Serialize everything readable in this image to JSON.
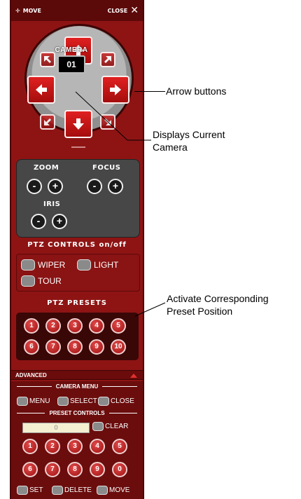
{
  "header": {
    "move_label": "MOVE",
    "close_label": "CLOSE"
  },
  "camera": {
    "label": "CAMERA",
    "number": "01"
  },
  "lens": {
    "zoom_label": "ZOOM",
    "focus_label": "FOCUS",
    "iris_label": "IRIS",
    "minus": "-",
    "plus": "+"
  },
  "ptz_controls": {
    "title": "PTZ CONTROLS on/off",
    "wiper": "WIPER",
    "light": "LIGHT",
    "tour": "TOUR"
  },
  "ptz_presets": {
    "title": "PTZ PRESETS",
    "buttons": [
      "1",
      "2",
      "3",
      "4",
      "5",
      "6",
      "7",
      "8",
      "9",
      "10"
    ]
  },
  "advanced": {
    "label": "ADVANCED"
  },
  "camera_menu": {
    "title": "CAMERA MENU",
    "menu": "MENU",
    "select": "SELECT",
    "close": "CLOSE"
  },
  "preset_controls": {
    "title": "PRESET CONTROLS",
    "entry_value": "0",
    "clear": "CLEAR",
    "keys": [
      "1",
      "2",
      "3",
      "4",
      "5",
      "6",
      "7",
      "8",
      "9",
      "0"
    ],
    "set": "SET",
    "delete": "DELETE",
    "move": "MOVE"
  },
  "annotations": {
    "arrow_buttons": "Arrow buttons",
    "displays_camera_1": "Displays Current",
    "displays_camera_2": "Camera",
    "activate_preset_1": "Activate Corresponding",
    "activate_preset_2": "Preset Position"
  },
  "colors": {
    "panel": "#8e1414",
    "panel_dark": "#5c0909",
    "button_red": "#d41b1b"
  }
}
